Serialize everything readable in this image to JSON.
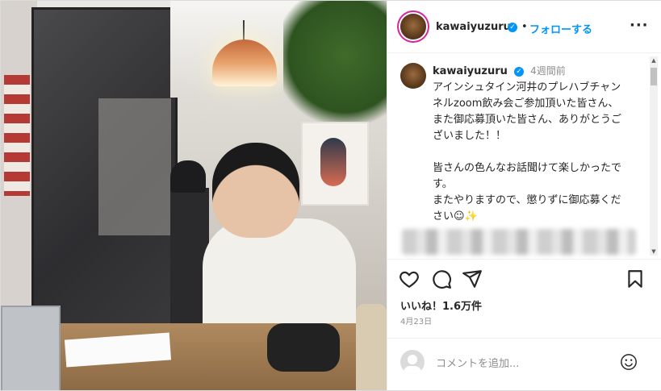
{
  "header": {
    "username": "kawaiyuzuru",
    "separator": "•",
    "follow_label": "フォローする",
    "more_icon": "more-horizontal-icon"
  },
  "caption": {
    "username": "kawaiyuzuru",
    "time": "4週間前",
    "text": "アインシュタイン河井のプレハブチャンネルzoom飲み会ご参加頂いた皆さん、また御応募頂いた皆さん、ありがとうございました！！\n\n皆さんの色んなお話聞けて楽しかったです。\nまたやりますので、懲りずに御応募ください☺✨"
  },
  "actions": {
    "like_icon": "heart-icon",
    "comment_icon": "comment-icon",
    "share_icon": "share-icon",
    "save_icon": "bookmark-icon"
  },
  "likes_text": "いいね！1.6万件",
  "date_text": "4月23日",
  "comment_box": {
    "placeholder": "コメントを追加...",
    "emoji_icon": "emoji-icon"
  },
  "colors": {
    "accent": "#0095f6",
    "story_ring": "#d6249f",
    "border": "#efefef"
  }
}
